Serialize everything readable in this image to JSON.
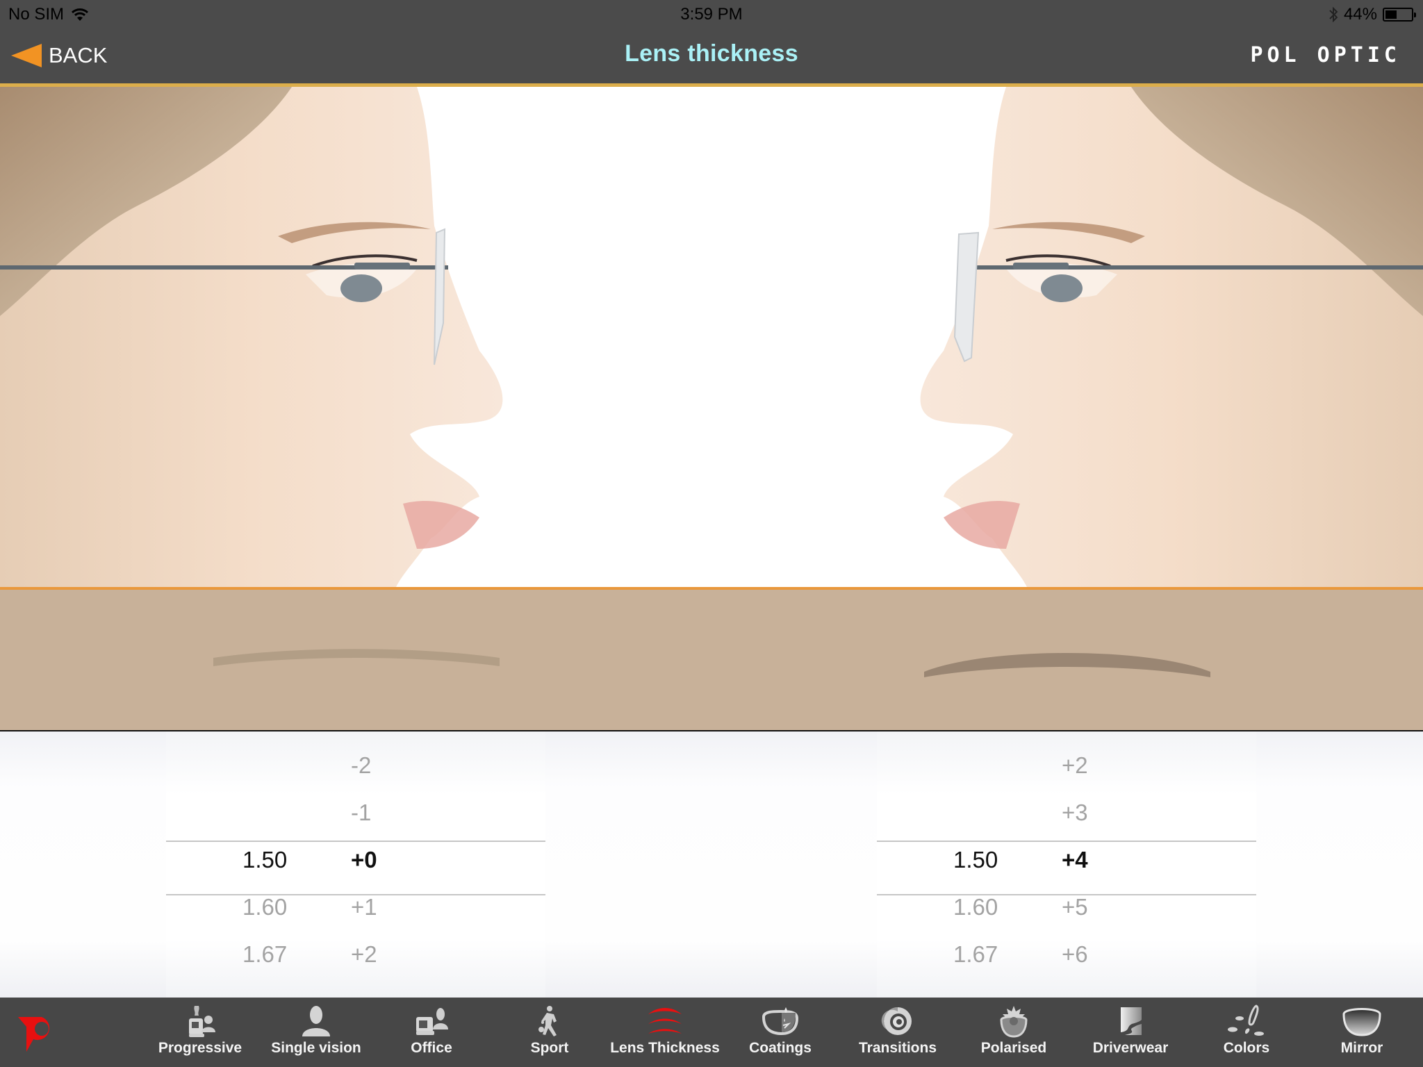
{
  "status_bar": {
    "carrier": "No SIM",
    "time": "3:59 PM",
    "battery_percent_label": "44%",
    "battery_level": 0.44,
    "icons": [
      "wifi-icon",
      "bluetooth-icon",
      "battery-icon"
    ]
  },
  "nav": {
    "back_label": "BACK",
    "title": "Lens thickness",
    "brand": "POL OPTIC"
  },
  "colors": {
    "bar_background": "#4b4b4b",
    "accent_orange": "#f29323",
    "title_cyan": "#aaf1f6",
    "gold_border": "#dcae4b",
    "lens_area_tan": "#c8b199",
    "lens_thin_fill": "#b29e86",
    "lens_thick_fill": "#9a8673",
    "active_tab_red": "#e81010",
    "tab_bar_background": "#474747"
  },
  "photos": {
    "left": {
      "description": "woman-profile-facing-right-thin-lens"
    },
    "right": {
      "description": "woman-profile-facing-left-thick-lens"
    }
  },
  "lens_profiles": {
    "left": {
      "label": "minus-lens-thin"
    },
    "right": {
      "label": "plus-lens-thick"
    }
  },
  "pickers": [
    {
      "name": "left",
      "rows": [
        {
          "index": "",
          "power": "-2"
        },
        {
          "index": "",
          "power": "-1"
        },
        {
          "index": "1.50",
          "power": "+0",
          "selected": true
        },
        {
          "index": "1.60",
          "power": "+1"
        },
        {
          "index": "1.67",
          "power": "+2"
        }
      ],
      "selected_index": "1.50",
      "selected_power": "+0"
    },
    {
      "name": "right",
      "rows": [
        {
          "index": "",
          "power": "+2"
        },
        {
          "index": "",
          "power": "+3"
        },
        {
          "index": "1.50",
          "power": "+4",
          "selected": true
        },
        {
          "index": "1.60",
          "power": "+5"
        },
        {
          "index": "1.67",
          "power": "+6"
        }
      ],
      "selected_index": "1.50",
      "selected_power": "+4"
    }
  ],
  "tab_bar": {
    "logo": "pol-optic-logo",
    "active": "Lens Thickness",
    "items": [
      {
        "label": "Progressive",
        "icon": "progressive-icon"
      },
      {
        "label": "Single vision",
        "icon": "single-vision-icon"
      },
      {
        "label": "Office",
        "icon": "office-icon"
      },
      {
        "label": "Sport",
        "icon": "sport-icon"
      },
      {
        "label": "Lens Thickness",
        "icon": "lens-thickness-icon"
      },
      {
        "label": "Coatings",
        "icon": "coatings-icon"
      },
      {
        "label": "Transitions",
        "icon": "transitions-icon"
      },
      {
        "label": "Polarised",
        "icon": "polarised-icon"
      },
      {
        "label": "Driverwear",
        "icon": "driverwear-icon"
      },
      {
        "label": "Colors",
        "icon": "colors-icon"
      },
      {
        "label": "Mirror",
        "icon": "mirror-icon"
      }
    ]
  }
}
